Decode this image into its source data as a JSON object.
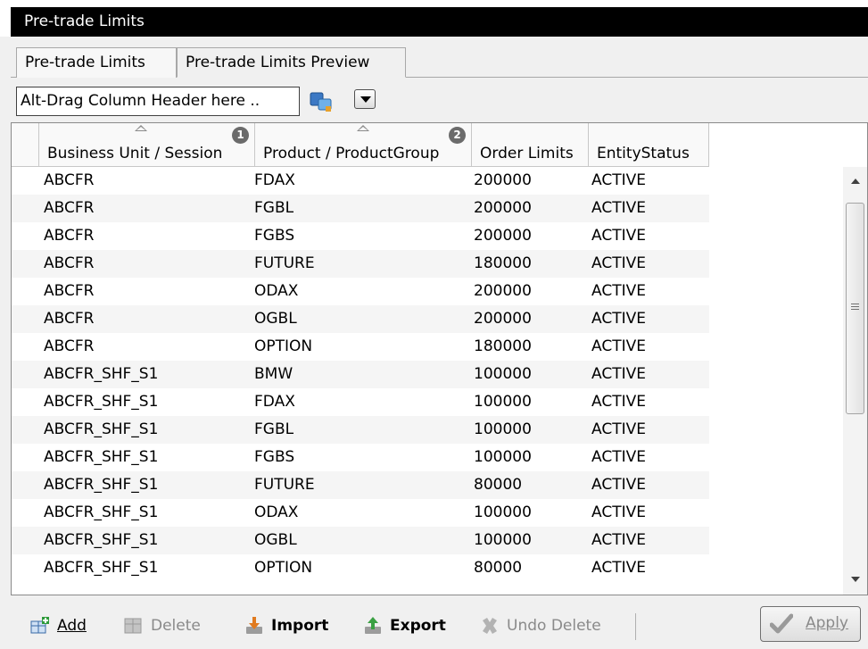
{
  "window": {
    "title": "Pre-trade Limits"
  },
  "tabs": [
    {
      "label": "Pre-trade Limits"
    },
    {
      "label": "Pre-trade Limits Preview"
    }
  ],
  "grouping": {
    "drop_zone_text": "Alt-Drag Column Header here ..",
    "icon": "group-columns-icon",
    "dropdown_icon": "triangle-down-icon"
  },
  "table": {
    "columns": [
      {
        "label": "Business Unit / Session",
        "sort_icon": "sort-ascending-icon",
        "badge": "1"
      },
      {
        "label": "Product / ProductGroup",
        "sort_icon": "sort-ascending-icon",
        "badge": "2"
      },
      {
        "label": "Order Limits"
      },
      {
        "label": "EntityStatus"
      }
    ],
    "rows": [
      [
        "ABCFR",
        "FDAX",
        "200000",
        "ACTIVE"
      ],
      [
        "ABCFR",
        "FGBL",
        "200000",
        "ACTIVE"
      ],
      [
        "ABCFR",
        "FGBS",
        "200000",
        "ACTIVE"
      ],
      [
        "ABCFR",
        "FUTURE",
        "180000",
        "ACTIVE"
      ],
      [
        "ABCFR",
        "ODAX",
        "200000",
        "ACTIVE"
      ],
      [
        "ABCFR",
        "OGBL",
        "200000",
        "ACTIVE"
      ],
      [
        "ABCFR",
        "OPTION",
        "180000",
        "ACTIVE"
      ],
      [
        "ABCFR_SHF_S1",
        "BMW",
        "100000",
        "ACTIVE"
      ],
      [
        "ABCFR_SHF_S1",
        "FDAX",
        "100000",
        "ACTIVE"
      ],
      [
        "ABCFR_SHF_S1",
        "FGBL",
        "100000",
        "ACTIVE"
      ],
      [
        "ABCFR_SHF_S1",
        "FGBS",
        "100000",
        "ACTIVE"
      ],
      [
        "ABCFR_SHF_S1",
        "FUTURE",
        "80000",
        "ACTIVE"
      ],
      [
        "ABCFR_SHF_S1",
        "ODAX",
        "100000",
        "ACTIVE"
      ],
      [
        "ABCFR_SHF_S1",
        "OGBL",
        "100000",
        "ACTIVE"
      ],
      [
        "ABCFR_SHF_S1",
        "OPTION",
        "80000",
        "ACTIVE"
      ]
    ]
  },
  "toolbar": {
    "add": {
      "label": "Add",
      "icon": "add-row-icon"
    },
    "delete": {
      "label": "Delete",
      "icon": "delete-row-icon"
    },
    "import": {
      "label": "Import",
      "icon": "import-icon"
    },
    "export": {
      "label": "Export",
      "icon": "export-icon"
    },
    "undo_delete": {
      "label": "Undo Delete",
      "icon": "undo-delete-icon"
    },
    "apply": {
      "label": "Apply",
      "icon": "checkmark-icon"
    }
  }
}
